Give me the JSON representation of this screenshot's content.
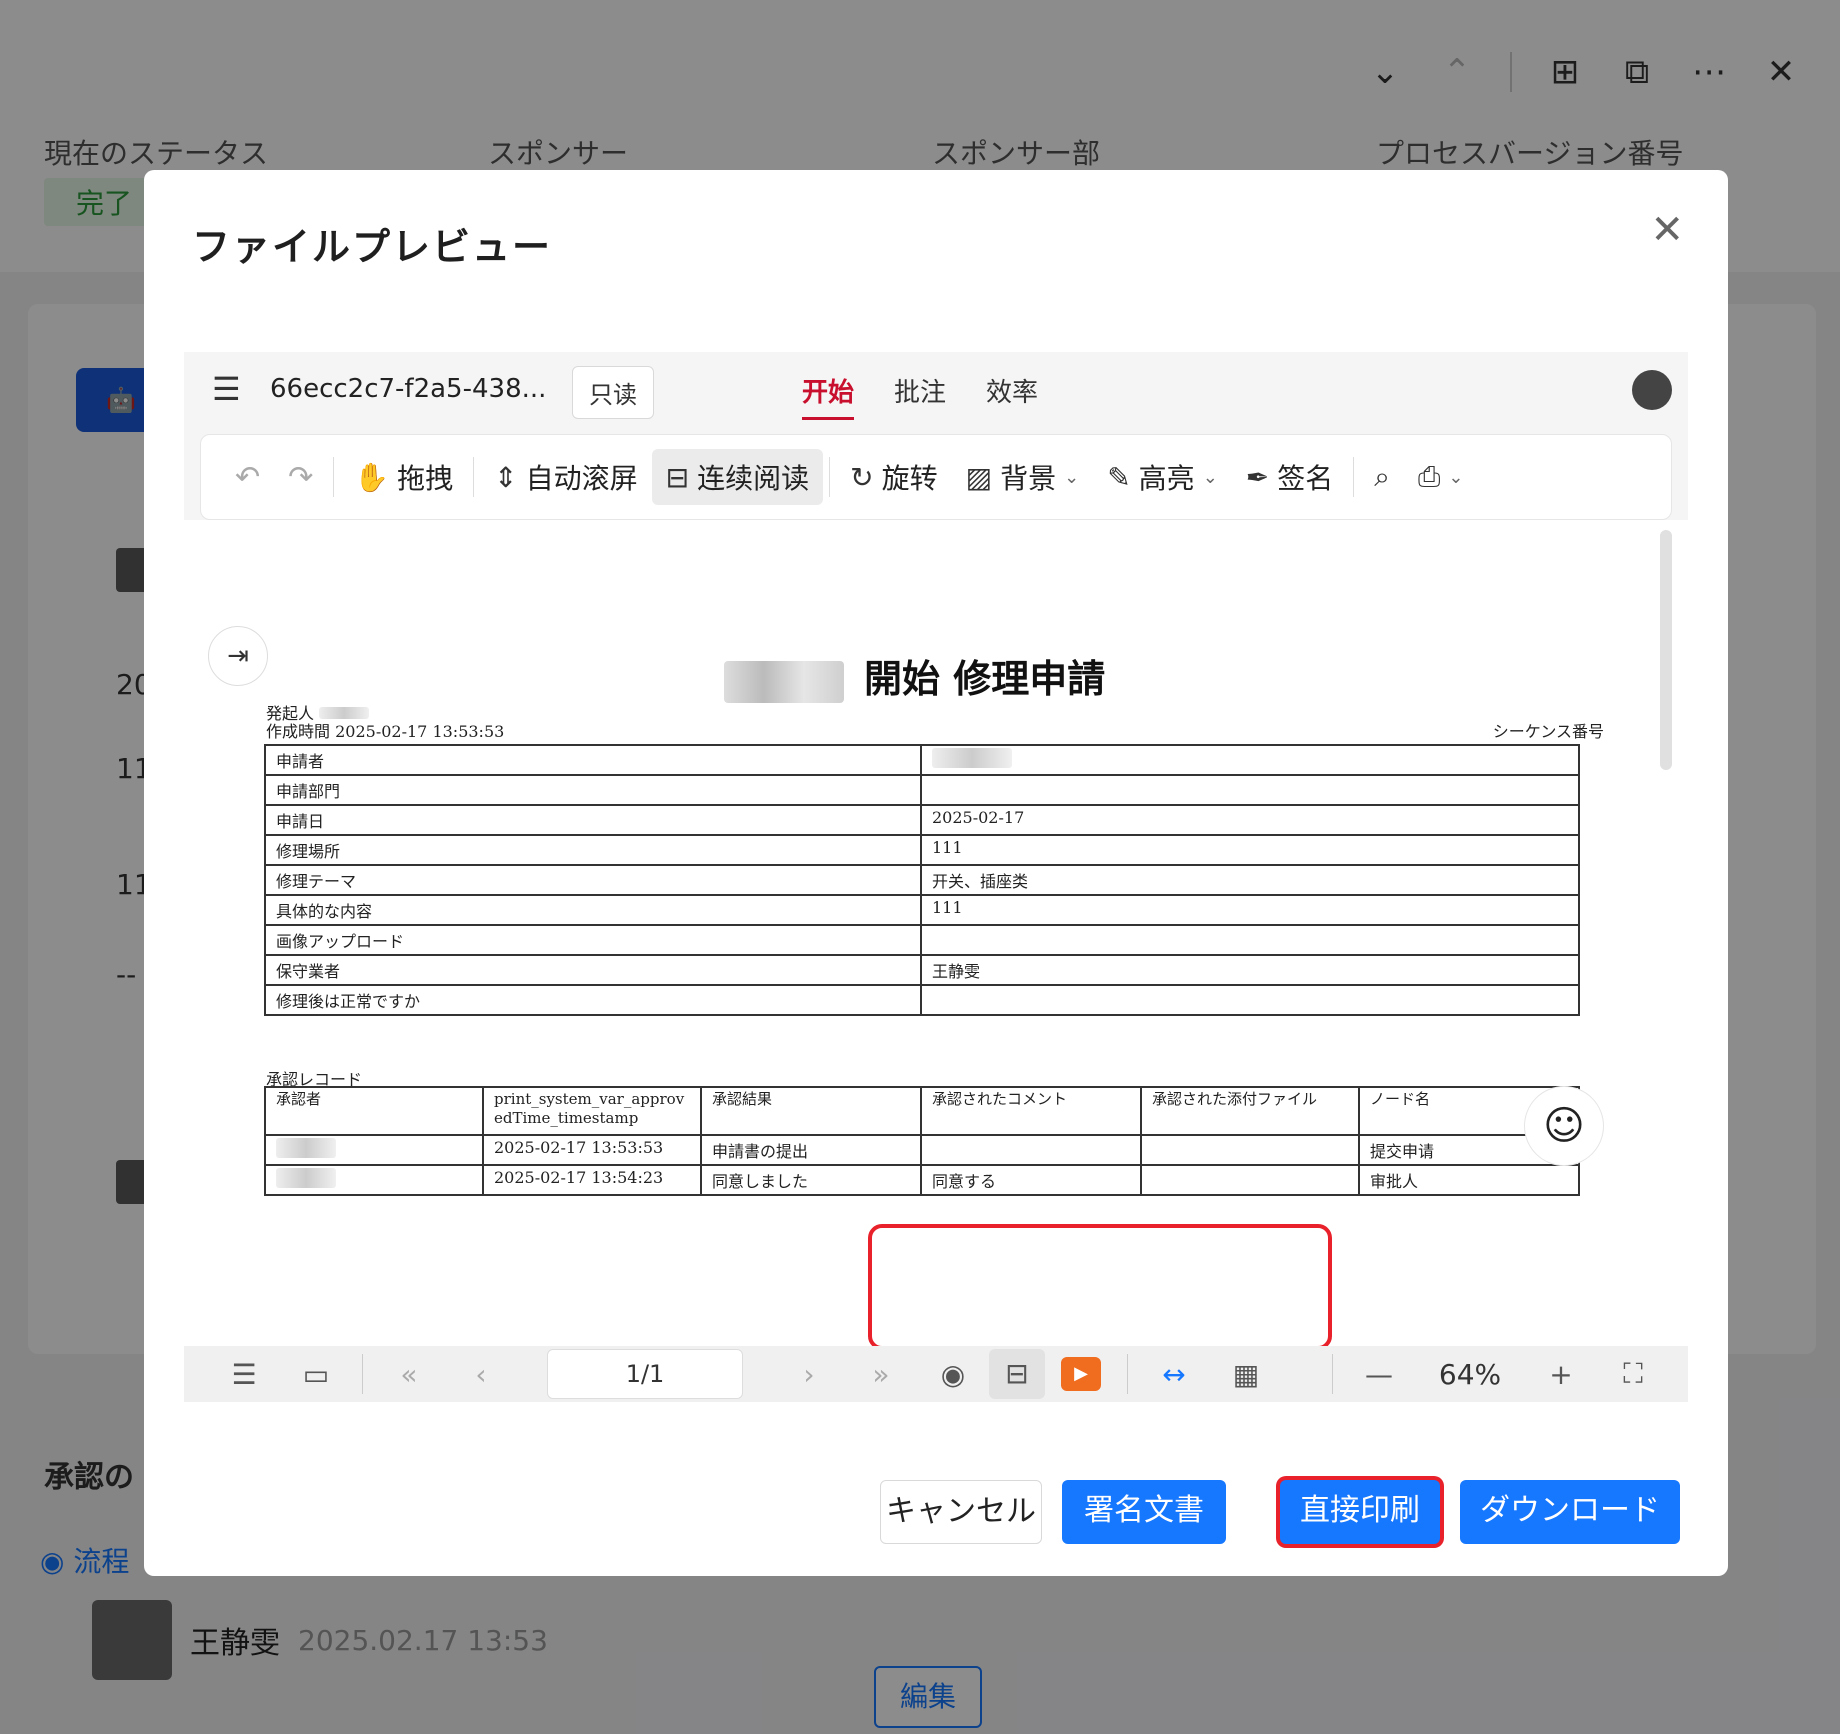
{
  "background": {
    "fields": [
      "現在のステータス",
      "スポンサー",
      "スポンサー部",
      "プロセスバージョン番号"
    ],
    "status_badge": "完了",
    "side_texts": [
      "20",
      "11",
      "11",
      "--"
    ],
    "section_title": "承認の",
    "flow_link": "流程",
    "user_name": "王静雯",
    "user_time": "2025.02.17 13:53",
    "edit_button": "編集"
  },
  "modal": {
    "title": "ファイルプレビュー",
    "close_icon": "close-icon"
  },
  "viewer": {
    "file_name": "66ecc2c7-f2a5-438...",
    "readonly_label": "只读",
    "tabs": [
      {
        "label": "开始",
        "active": true
      },
      {
        "label": "批注",
        "active": false
      },
      {
        "label": "效率",
        "active": false
      }
    ],
    "toolbar": {
      "drag": "拖拽",
      "auto_scroll": "自动滚屏",
      "continuous_read": "连续阅读",
      "rotate": "旋转",
      "background": "背景",
      "highlight": "高亮",
      "signature": "签名"
    },
    "bottom": {
      "page": "1/1",
      "zoom": "64%"
    }
  },
  "document": {
    "title": "開始  修理申請",
    "initiator_label": "発起人",
    "created_label": "作成時間",
    "created_value": "2025-02-17 13:53:53",
    "sequence_label": "シーケンス番号",
    "form_rows": [
      {
        "key": "申請者",
        "value": ""
      },
      {
        "key": "申請部門",
        "value": ""
      },
      {
        "key": "申請日",
        "value": "2025-02-17"
      },
      {
        "key": "修理場所",
        "value": "111"
      },
      {
        "key": "修理テーマ",
        "value": "开关、插座类"
      },
      {
        "key": "具体的な内容",
        "value": "111"
      },
      {
        "key": "画像アップロード",
        "value": ""
      },
      {
        "key": "保守業者",
        "value": "王静雯"
      },
      {
        "key": "修理後は正常ですか",
        "value": ""
      }
    ],
    "approval_label": "承認レコード",
    "approval_headers": [
      "承認者",
      "print_system_var_approvedTime_timestamp",
      "承認結果",
      "承認されたコメント",
      "承認された添付ファイル",
      "ノード名"
    ],
    "approval_rows": [
      [
        "",
        "2025-02-17 13:53:53",
        "申請書の提出",
        "",
        "",
        "提交申请"
      ],
      [
        "",
        "2025-02-17 13:54:23",
        "同意しました",
        "同意する",
        "",
        "审批人"
      ]
    ]
  },
  "footer": {
    "cancel": "キャンセル",
    "sign_document": "署名文書",
    "direct_print": "直接印刷",
    "download": "ダウンロード"
  },
  "colors": {
    "primary": "#1677ff",
    "highlight_red": "#e8212b",
    "tab_active": "#c8102e",
    "play_orange": "#f06c1e"
  }
}
